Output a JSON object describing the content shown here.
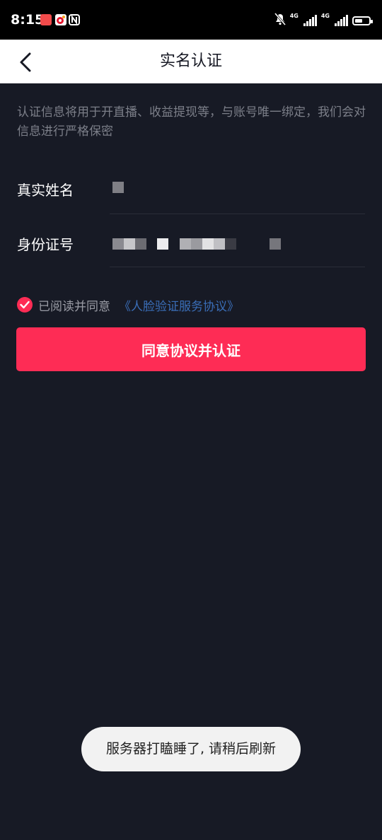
{
  "status_bar": {
    "time": "8:15",
    "network_1": "4G",
    "network_2": "4G",
    "battery_percent": 40,
    "icons": [
      "app-red-icon",
      "weibo-icon",
      "nfc-icon",
      "mute-icon",
      "signal-icon",
      "signal-icon",
      "battery-icon"
    ]
  },
  "header": {
    "title": "实名认证",
    "back_icon": "chevron-left-icon"
  },
  "notice": "认证信息将用于开直播、收益提现等，与账号唯一绑定，我们会对信息进行严格保密",
  "form": {
    "name_label": "真实姓名",
    "id_label": "身份证号"
  },
  "agreement": {
    "checked": true,
    "text": "已阅读并同意",
    "link": "《人脸验证服务协议》"
  },
  "submit_label": "同意协议并认证",
  "toast": "服务器打瞌睡了, 请稍后刷新",
  "colors": {
    "background": "#171a25",
    "accent": "#fe2c55",
    "link": "#3a6eb8",
    "header_bg": "#ffffff"
  }
}
